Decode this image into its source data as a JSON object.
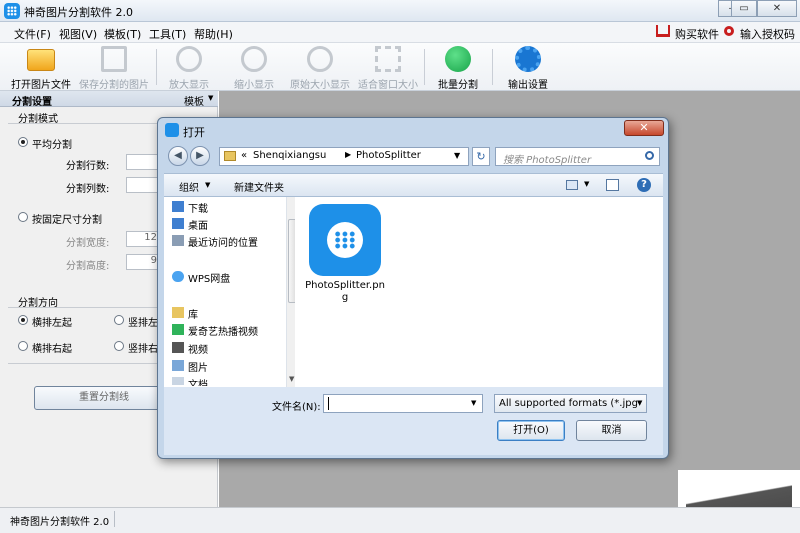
{
  "window": {
    "title": "神奇图片分割软件 2.0",
    "controls": [
      "minimize",
      "maximize",
      "close"
    ]
  },
  "menu": {
    "items": [
      "文件(F)",
      "视图(V)",
      "模板(T)",
      "工具(T)",
      "帮助(H)"
    ],
    "buy": "购买软件",
    "license": "输入授权码"
  },
  "toolbar": {
    "open": "打开图片文件",
    "save": "保存分割的图片",
    "zoom_in": "放大显示",
    "zoom_out": "缩小显示",
    "original": "原始大小显示",
    "fit": "适合窗口大小",
    "batch": "批量分割",
    "output": "输出设置"
  },
  "panel": {
    "title": "分割设置",
    "template": "模板",
    "mode_group": "分割模式",
    "even": "平均分割",
    "rows": "分割行数:",
    "cols": "分割列数:",
    "fixed": "按固定尺寸分割",
    "width": "分割宽度:",
    "width_val": "12",
    "height": "分割高度:",
    "height_val": "9",
    "dir_group": "分割方向",
    "h_left": "横排左起",
    "v_left": "竖排左",
    "h_right": "横排右起",
    "v_right": "竖排右",
    "reset": "重置分割线"
  },
  "status": {
    "text": "神奇图片分割软件 2.0"
  },
  "dialog": {
    "title": "打开",
    "path_prefix": "«",
    "path": [
      "Shenqixiangsu",
      "PhotoSplitter"
    ],
    "search_placeholder": "搜索 PhotoSplitter",
    "organize": "组织",
    "new_folder": "新建文件夹",
    "nav": [
      "下载",
      "桌面",
      "最近访问的位置",
      "WPS网盘",
      "库",
      "爱奇艺热播视频",
      "视频",
      "图片",
      "文档"
    ],
    "file_name": "PhotoSplitter.png",
    "filename_label": "文件名(N):",
    "filename_value": "",
    "filter": "All supported formats (*.jpg",
    "open_btn": "打开(O)",
    "cancel_btn": "取消"
  },
  "colors": {
    "accent": "#1e90e8",
    "title_bar": "#dfe7f1",
    "dialog_frame": "#c4d6ea",
    "gray_area": "#a9a9a9"
  }
}
